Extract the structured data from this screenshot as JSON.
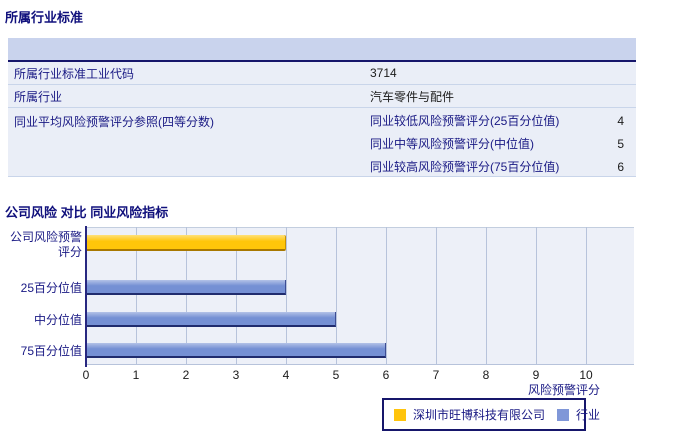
{
  "sections": {
    "industry_standard_title": "所属行业标准",
    "comparison_title": "公司风险 对比 同业风险指标"
  },
  "table": {
    "rows": [
      {
        "label": "所属行业标准工业代码",
        "value": "3714"
      },
      {
        "label": "所属行业",
        "value": "汽车零件与配件"
      }
    ],
    "quartile_row": {
      "label": "同业平均风险预警评分参照(四等分数)",
      "items": [
        {
          "label": "同业较低风险预警评分(25百分位值)",
          "value": "4"
        },
        {
          "label": "同业中等风险预警评分(中位值)",
          "value": "5"
        },
        {
          "label": "同业较高风险预警评分(75百分位值)",
          "value": "6"
        }
      ]
    }
  },
  "chart_data": {
    "type": "bar",
    "orientation": "horizontal",
    "title": "",
    "categories": [
      "公司风险预警评分",
      "25百分位值",
      "中分位值",
      "75百分位值"
    ],
    "series": [
      {
        "name": "深圳市旺博科技有限公司",
        "color": "#ffc60a",
        "values": [
          4,
          null,
          null,
          null
        ]
      },
      {
        "name": "行业",
        "color": "#7590d4",
        "values": [
          null,
          4,
          5,
          6
        ]
      }
    ],
    "legend_colors": {
      "company": "#ffc40c",
      "industry": "#8097d8"
    },
    "xlabel": "风险预警评分",
    "xlim": [
      0,
      10
    ],
    "xticks": [
      0,
      1,
      2,
      3,
      4,
      5,
      6,
      7,
      8,
      9,
      10
    ],
    "grid": true,
    "legend_position": "bottom"
  }
}
